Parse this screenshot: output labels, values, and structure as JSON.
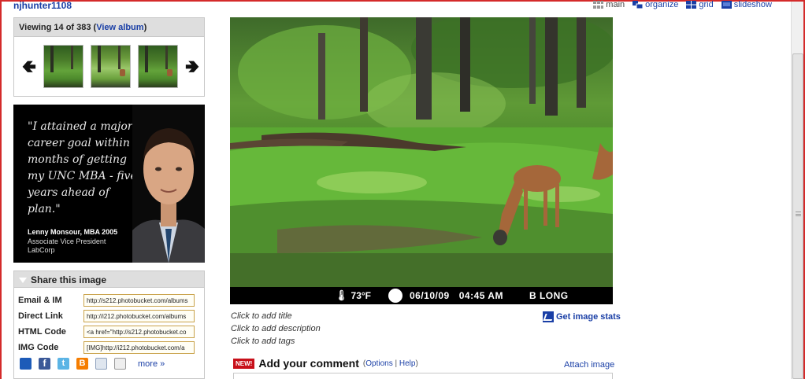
{
  "header": {
    "username": "njhunter1108",
    "nav": [
      {
        "label": "main",
        "icon": "main-icon",
        "active": true
      },
      {
        "label": "organize",
        "icon": "organize-icon",
        "active": false
      },
      {
        "label": "grid",
        "icon": "grid-icon",
        "active": false
      },
      {
        "label": "slideshow",
        "icon": "slideshow-icon",
        "active": false
      }
    ]
  },
  "viewer": {
    "viewing_text": "Viewing 14 of 383 (",
    "view_album_label": "View album",
    "close_paren": ")",
    "prev_icon": "left-arrow-icon",
    "next_icon": "right-arrow-icon",
    "thumbnails": [
      "thumbnail-13",
      "thumbnail-14",
      "thumbnail-15"
    ]
  },
  "ad": {
    "quote": "\"I attained a major career goal within months of getting my UNC MBA - five years ahead of plan.\"",
    "name": "Lenny Monsour, MBA 2005",
    "role_line1": "Associate Vice President",
    "role_line2": "LabCorp"
  },
  "share": {
    "title": "Share this image",
    "rows": [
      {
        "label": "Email & IM",
        "value": "http://s212.photobucket.com/albums"
      },
      {
        "label": "Direct Link",
        "value": "http://i212.photobucket.com/albums"
      },
      {
        "label": "HTML Code",
        "value": "<a href=\"http://s212.photobucket.co"
      },
      {
        "label": "IMG Code",
        "value": "[IMG]http://i212.photobucket.com/a"
      }
    ],
    "social_icons": [
      "myspace-icon",
      "facebook-icon",
      "twitter-icon",
      "blogger-icon",
      "attach-icon",
      "email-icon"
    ],
    "more_label": "more »"
  },
  "photo": {
    "stamp_temp": "73°F",
    "stamp_date": "06/10/09",
    "stamp_time": "04:45 AM",
    "stamp_camera": "B LONG"
  },
  "meta": {
    "add_title": "Click to add title",
    "add_description": "Click to add description",
    "add_tags": "Click to add tags",
    "stats_label": "Get image stats"
  },
  "comment": {
    "badge": "NEW!",
    "title": "Add your comment",
    "options_open": "(",
    "options_label": "Options",
    "separator": " | ",
    "help_label": "Help",
    "options_close": ")",
    "attach_label": "Attach image"
  },
  "colors": {
    "link": "#1a3fa6",
    "frame": "#d42a2a",
    "panel_header": "#dedede"
  }
}
